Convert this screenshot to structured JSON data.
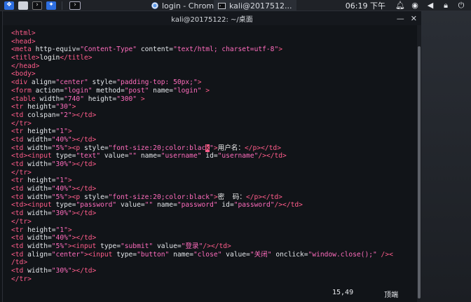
{
  "taskbar": {
    "tasks": [
      {
        "label": "login - Chrom..."
      },
      {
        "label": "kali@2017512..."
      }
    ],
    "clock": "06:19 下午"
  },
  "window": {
    "title": "kali@20175122: ~/桌面"
  },
  "code": [
    [
      [
        "t",
        "<html>"
      ]
    ],
    [
      [
        "t",
        "<head>"
      ]
    ],
    [
      [
        "t",
        "<meta "
      ],
      [
        "a",
        "http-equiv="
      ],
      [
        "s",
        "\"Content-Type\""
      ],
      [
        "a",
        " content="
      ],
      [
        "s",
        "\"text/html; charset=utf-8\""
      ],
      [
        "t",
        ">"
      ]
    ],
    [
      [
        "t",
        "<title>"
      ],
      [
        "x",
        "login"
      ],
      [
        "t",
        "</title>"
      ]
    ],
    [
      [
        "t",
        "</head>"
      ]
    ],
    [
      [
        "t",
        "<body>"
      ]
    ],
    [
      [
        "t",
        "<div "
      ],
      [
        "a",
        "align="
      ],
      [
        "s",
        "\"center\""
      ],
      [
        "a",
        " style="
      ],
      [
        "s",
        "\"padding-top: 50px;\""
      ],
      [
        "t",
        ">"
      ]
    ],
    [
      [
        "t",
        "<form "
      ],
      [
        "a",
        "action="
      ],
      [
        "s",
        "\"login\""
      ],
      [
        "a",
        " method="
      ],
      [
        "s",
        "\"post\""
      ],
      [
        "a",
        " name="
      ],
      [
        "s",
        "\"login\""
      ],
      [
        "t",
        " >"
      ]
    ],
    [
      [
        "t",
        "<table "
      ],
      [
        "a",
        "width="
      ],
      [
        "s",
        "\"740\""
      ],
      [
        "a",
        " height="
      ],
      [
        "s",
        "\"300\""
      ],
      [
        "t",
        " >"
      ]
    ],
    [
      [
        "t",
        "<tr "
      ],
      [
        "a",
        "height="
      ],
      [
        "s",
        "\"30\""
      ],
      [
        "t",
        ">"
      ]
    ],
    [
      [
        "t",
        "<td "
      ],
      [
        "a",
        "colspan="
      ],
      [
        "s",
        "\"2\""
      ],
      [
        "t",
        "></td>"
      ]
    ],
    [
      [
        "t",
        "</tr>"
      ]
    ],
    [
      [
        "t",
        "<tr "
      ],
      [
        "a",
        "height="
      ],
      [
        "s",
        "\"1\""
      ],
      [
        "t",
        ">"
      ]
    ],
    [
      [
        "t",
        "<td "
      ],
      [
        "a",
        "width="
      ],
      [
        "s",
        "\"40%\""
      ],
      [
        "t",
        "></td>"
      ]
    ],
    [
      [
        "t",
        "<td "
      ],
      [
        "a",
        "width="
      ],
      [
        "s",
        "\"5%\""
      ],
      [
        "t",
        "><p "
      ],
      [
        "a",
        "style="
      ],
      [
        "s",
        "\"font-size:20;color:blac"
      ],
      [
        "cursor",
        "k"
      ],
      [
        "s",
        "\""
      ],
      [
        "t",
        ">"
      ],
      [
        "x",
        "用户名："
      ],
      [
        "t",
        "</p></td>"
      ]
    ],
    [
      [
        "t",
        "<td><input "
      ],
      [
        "a",
        "type="
      ],
      [
        "s",
        "\"text\""
      ],
      [
        "a",
        " value="
      ],
      [
        "s",
        "\"\""
      ],
      [
        "a",
        " name="
      ],
      [
        "s",
        "\"username\""
      ],
      [
        "a",
        " id="
      ],
      [
        "s",
        "\"username\""
      ],
      [
        "t",
        "/></td>"
      ]
    ],
    [
      [
        "t",
        "<td "
      ],
      [
        "a",
        "width="
      ],
      [
        "s",
        "\"30%\""
      ],
      [
        "t",
        "></td>"
      ]
    ],
    [
      [
        "t",
        "</tr>"
      ]
    ],
    [
      [
        "t",
        "<tr "
      ],
      [
        "a",
        "height="
      ],
      [
        "s",
        "\"1\""
      ],
      [
        "t",
        ">"
      ]
    ],
    [
      [
        "t",
        "<td "
      ],
      [
        "a",
        "width="
      ],
      [
        "s",
        "\"40%\""
      ],
      [
        "t",
        "></td>"
      ]
    ],
    [
      [
        "t",
        "<td "
      ],
      [
        "a",
        "width="
      ],
      [
        "s",
        "\"5%\""
      ],
      [
        "t",
        "><p "
      ],
      [
        "a",
        "style="
      ],
      [
        "s",
        "\"font-size:20;color:black\""
      ],
      [
        "t",
        ">"
      ],
      [
        "x",
        "密  码："
      ],
      [
        "t",
        "</p></td>"
      ]
    ],
    [
      [
        "t",
        "<td><input "
      ],
      [
        "a",
        "type="
      ],
      [
        "s",
        "\"password\""
      ],
      [
        "a",
        " value="
      ],
      [
        "s",
        "\"\""
      ],
      [
        "a",
        " name="
      ],
      [
        "s",
        "\"password\""
      ],
      [
        "a",
        " id="
      ],
      [
        "s",
        "\"password\""
      ],
      [
        "t",
        "/></td>"
      ]
    ],
    [
      [
        "t",
        "<td "
      ],
      [
        "a",
        "width="
      ],
      [
        "s",
        "\"30%\""
      ],
      [
        "t",
        "></td>"
      ]
    ],
    [
      [
        "t",
        "</tr>"
      ]
    ],
    [
      [
        "t",
        "<tr "
      ],
      [
        "a",
        "height="
      ],
      [
        "s",
        "\"1\""
      ],
      [
        "t",
        ">"
      ]
    ],
    [
      [
        "t",
        "<td "
      ],
      [
        "a",
        "width="
      ],
      [
        "s",
        "\"40%\""
      ],
      [
        "t",
        "></td>"
      ]
    ],
    [
      [
        "t",
        "<td "
      ],
      [
        "a",
        "width="
      ],
      [
        "s",
        "\"5%\""
      ],
      [
        "t",
        "><input "
      ],
      [
        "a",
        "type="
      ],
      [
        "s",
        "\"submit\""
      ],
      [
        "a",
        " value="
      ],
      [
        "s",
        "\"登录\""
      ],
      [
        "t",
        "/></td>"
      ]
    ],
    [
      [
        "t",
        "<td "
      ],
      [
        "a",
        "align="
      ],
      [
        "s",
        "\"center\""
      ],
      [
        "t",
        "><input "
      ],
      [
        "a",
        "type="
      ],
      [
        "s",
        "\"button\""
      ],
      [
        "a",
        " name="
      ],
      [
        "s",
        "\"close\""
      ],
      [
        "a",
        " value="
      ],
      [
        "s",
        "\"关闭\""
      ],
      [
        "a",
        " onclick="
      ],
      [
        "s",
        "\"window.close();\""
      ],
      [
        "t",
        " /><"
      ]
    ],
    [
      [
        "t",
        "/td>"
      ]
    ],
    [
      [
        "t",
        "<td "
      ],
      [
        "a",
        "width="
      ],
      [
        "s",
        "\"30%\""
      ],
      [
        "t",
        "></td>"
      ]
    ],
    [
      [
        "t",
        "</tr>"
      ]
    ]
  ],
  "status": {
    "position": "15,49",
    "scroll": "顶端"
  }
}
